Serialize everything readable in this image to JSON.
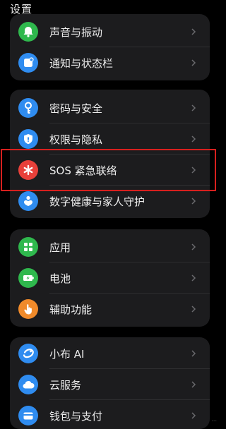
{
  "header": {
    "title": "设置"
  },
  "groups": [
    {
      "items": [
        {
          "label": "声音与振动",
          "icon": "bell-icon",
          "color": "#2fb84d"
        },
        {
          "label": "通知与状态栏",
          "icon": "notification-icon",
          "color": "#2f8cf0"
        }
      ]
    },
    {
      "items": [
        {
          "label": "密码与安全",
          "icon": "key-icon",
          "color": "#2f8cf0"
        },
        {
          "label": "权限与隐私",
          "icon": "shield-icon",
          "color": "#2f8cf0"
        },
        {
          "label": "SOS 紧急联络",
          "icon": "asterisk-icon",
          "color": "#e8403a"
        },
        {
          "label": "数字健康与家人守护",
          "icon": "family-icon",
          "color": "#2f8cf0"
        }
      ]
    },
    {
      "items": [
        {
          "label": "应用",
          "icon": "apps-grid-icon",
          "color": "#2fb84d"
        },
        {
          "label": "电池",
          "icon": "battery-icon",
          "color": "#2fb84d"
        },
        {
          "label": "辅助功能",
          "icon": "hand-icon",
          "color": "#f08a2a"
        }
      ]
    },
    {
      "items": [
        {
          "label": "小布 AI",
          "icon": "ai-assistant-icon",
          "color": "#2f8cf0"
        },
        {
          "label": "云服务",
          "icon": "cloud-icon",
          "color": "#2f8cf0"
        },
        {
          "label": "钱包与支付",
          "icon": "wallet-icon",
          "color": "#2f8cf0"
        }
      ]
    }
  ],
  "highlight_color": "#d8201e",
  "watermark": "..."
}
